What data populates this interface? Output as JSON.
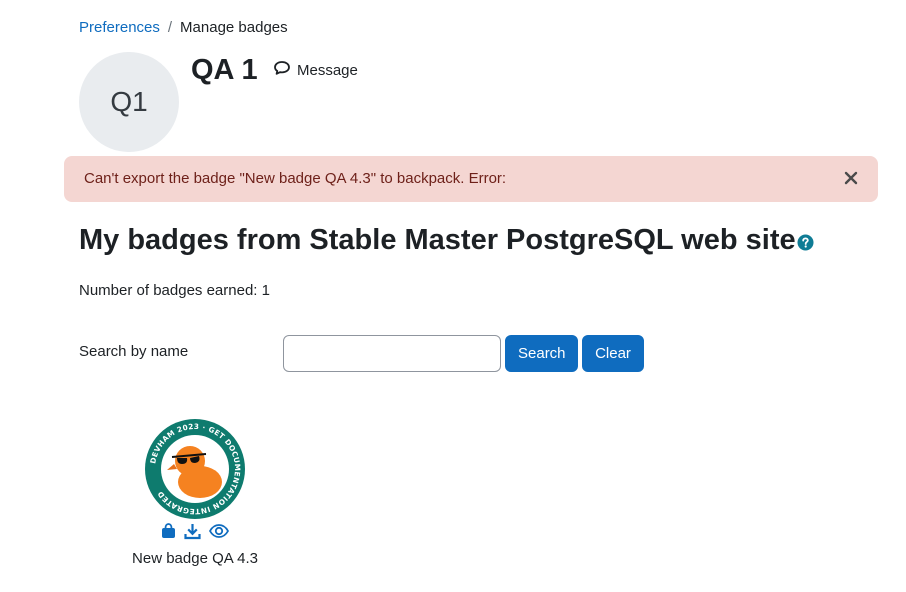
{
  "breadcrumb": {
    "items": [
      "Preferences",
      "Manage badges"
    ],
    "separator": "/"
  },
  "user": {
    "initials": "Q1",
    "name": "QA 1",
    "message_label": "Message"
  },
  "alert": {
    "text": "Can't export the badge \"New badge QA 4.3\" to backpack. Error:",
    "bg": "#f4d6d2",
    "color": "#6e211a"
  },
  "page": {
    "heading": "My badges from Stable Master PostgreSQL web site",
    "badge_count": "Number of badges earned: 1"
  },
  "search": {
    "label": "Search by name",
    "value": "",
    "search_button": "Search",
    "clear_button": "Clear"
  },
  "badges": [
    {
      "name": "New badge QA 4.3",
      "ring_text": "DEVHAM 2023 · GET DOCUMENTATION INTEGRATED",
      "actions": [
        "backpack-icon",
        "download-icon",
        "eye-icon"
      ]
    }
  ],
  "colors": {
    "link": "#0f6cbf",
    "primary": "#0f6cbf",
    "help": "#0f7c95",
    "badge_ring": "#0e7b6e",
    "duck": "#f58220"
  }
}
